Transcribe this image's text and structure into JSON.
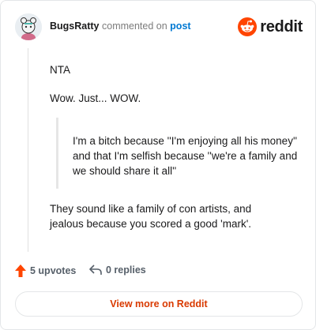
{
  "header": {
    "author": "BugsRatty",
    "action_text": "commented on",
    "post_link_label": "post",
    "logo_text": "reddit"
  },
  "comment": {
    "paragraph_1": "NTA",
    "paragraph_2": "Wow. Just... WOW.",
    "quote": "I'm a bitch because ''I'm enjoying all his money'' and that I'm selfish because ''we're a family and we should share it all''",
    "paragraph_3": "They sound like a family of con artists, and jealous because you scored a good 'mark'."
  },
  "actions": {
    "upvotes_label": "5 upvotes",
    "replies_label": "0 replies"
  },
  "cta_label": "View more on Reddit",
  "colors": {
    "brand_orange": "#ff4500",
    "link_blue": "#0079d3",
    "cta_text": "#d93a00",
    "upvote_icon": "#ff4500"
  },
  "icons": [
    "avatar",
    "reddit-logo-icon",
    "upvote-arrow-icon",
    "reply-icon"
  ]
}
